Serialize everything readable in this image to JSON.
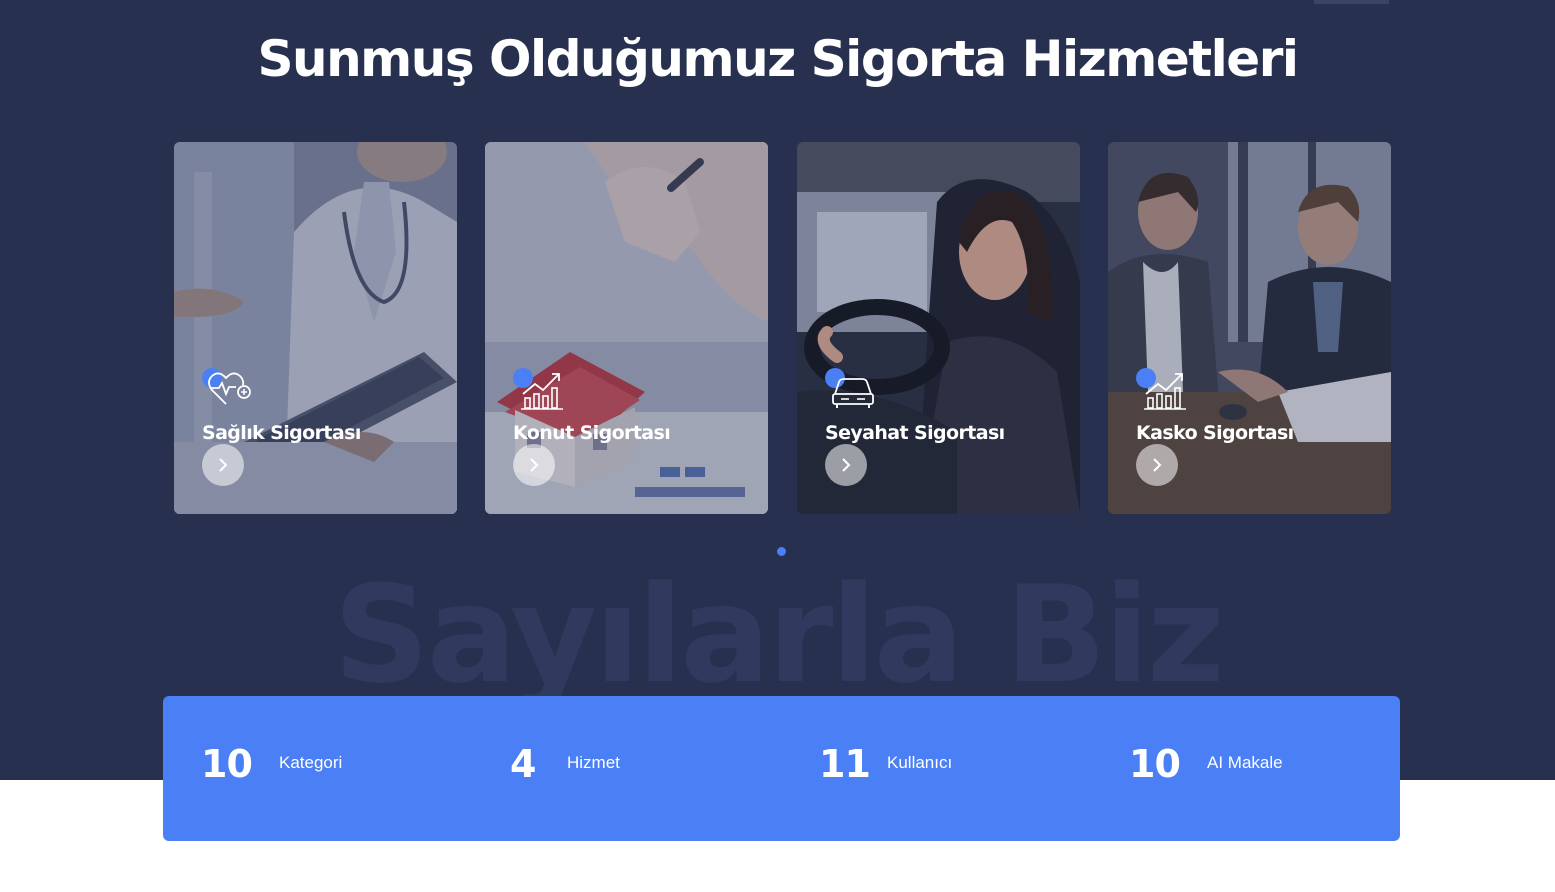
{
  "services": {
    "title": "Sunmuş Olduğumuz Sigorta Hizmetleri",
    "cards": [
      {
        "title": "Sağlık Sigortası",
        "icon": "health-heart-icon",
        "photo": "doctor-with-tablet"
      },
      {
        "title": "Konut Sigortası",
        "icon": "growth-chart-icon",
        "photo": "house-model-on-desk"
      },
      {
        "title": "Seyahat Sigortası",
        "icon": "car-icon",
        "photo": "woman-driving-car"
      },
      {
        "title": "Kasko Sigortası",
        "icon": "growth-chart-icon",
        "photo": "men-signing-documents"
      }
    ],
    "pagination_active": 1,
    "pagination_count": 1
  },
  "numbers": {
    "watermark": "Sayılarla Biz",
    "stats": [
      {
        "value": "10",
        "label": "Kategori"
      },
      {
        "value": "4",
        "label": "Hizmet"
      },
      {
        "value": "11",
        "label": "Kullanıcı"
      },
      {
        "value": "10",
        "label": "AI Makale"
      }
    ]
  },
  "colors": {
    "background": "#27304f",
    "accent": "#4a7ff5",
    "watermark": "#2f3a5e"
  }
}
